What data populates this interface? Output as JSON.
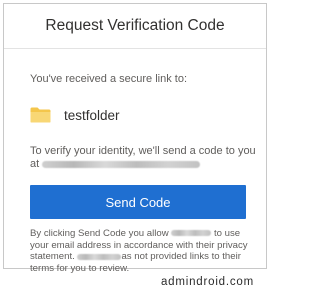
{
  "dialog": {
    "title": "Request Verification Code",
    "intro_text": "You've received a secure link to:",
    "folder": {
      "name": "testfolder",
      "icon": "folder-icon",
      "icon_color": "#f8d775"
    },
    "verify_text_line1": "To verify your identity, we'll send a code to you",
    "verify_text_prefix": "at",
    "send_button_label": "Send Code",
    "disclaimer": {
      "part1": "By clicking Send Code you allow",
      "part2": "to use your email address in accordance with their privacy statement.",
      "part3": "as not provided links to their terms for you to review."
    }
  },
  "watermark": "admindroid.com",
  "colors": {
    "accent": "#1f6fd1",
    "text_primary": "#323130",
    "text_secondary": "#605e5c",
    "border": "#c8c8c8"
  }
}
